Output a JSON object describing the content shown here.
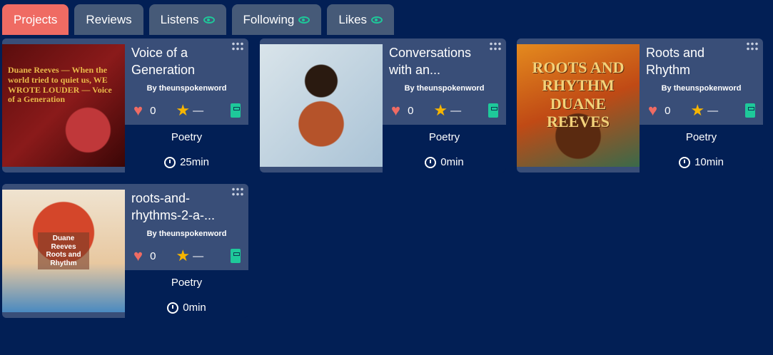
{
  "tabs": [
    {
      "label": "Projects",
      "active": true
    },
    {
      "label": "Reviews"
    },
    {
      "label": "Listens",
      "icon": "eye-icon"
    },
    {
      "label": "Following",
      "icon": "eye-icon"
    },
    {
      "label": "Likes",
      "icon": "eye-icon"
    }
  ],
  "projects": [
    {
      "title": "Voice of a Generation",
      "author": "By theunspokenword",
      "likes": "0",
      "rating": "—",
      "genre": "Poetry",
      "duration": "25min",
      "cover_text": "Duane Reeves — When the world tried to quiet us, WE WROTE LOUDER — Voice of a Generation"
    },
    {
      "title": "Conversations with an...",
      "author": "By theunspokenword",
      "likes": "0",
      "rating": "—",
      "genre": "Poetry",
      "duration": "0min"
    },
    {
      "title": "Roots and Rhythm",
      "author": "By theunspokenword",
      "likes": "0",
      "rating": "—",
      "genre": "Poetry",
      "duration": "10min",
      "cover_text": "ROOTS AND RHYTHM DUANE REEVES"
    },
    {
      "title": "roots-and-rhythms-2-a-...",
      "author": "By theunspokenword",
      "likes": "0",
      "rating": "—",
      "genre": "Poetry",
      "duration": "0min",
      "cover_text": "Duane Reeves Roots and Rhythm"
    }
  ]
}
